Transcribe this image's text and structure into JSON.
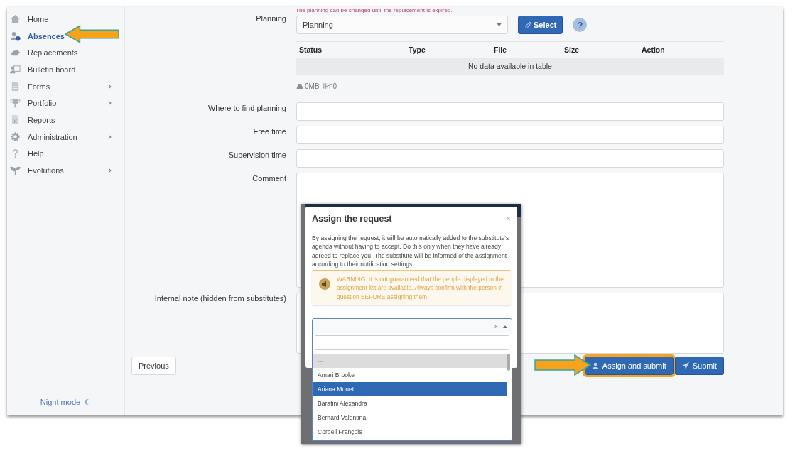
{
  "sidebar": {
    "items": [
      {
        "label": "Home",
        "selected": false,
        "has_submenu": false
      },
      {
        "label": "Absences",
        "selected": true,
        "has_submenu": false
      },
      {
        "label": "Replacements",
        "selected": false,
        "has_submenu": false
      },
      {
        "label": "Bulletin board",
        "selected": false,
        "has_submenu": false
      },
      {
        "label": "Forms",
        "selected": false,
        "has_submenu": true
      },
      {
        "label": "Portfolio",
        "selected": false,
        "has_submenu": true
      },
      {
        "label": "Reports",
        "selected": false,
        "has_submenu": false
      },
      {
        "label": "Administration",
        "selected": false,
        "has_submenu": true
      },
      {
        "label": "Help",
        "selected": false,
        "has_submenu": false
      },
      {
        "label": "Evolutions",
        "selected": false,
        "has_submenu": true
      }
    ],
    "night_mode": "Night mode"
  },
  "form": {
    "notice": "The planning can be changed until the replacement is expired.",
    "planning": {
      "label": "Planning",
      "value": "Planning",
      "select_button": "Select",
      "help": "?"
    },
    "files_table": {
      "columns": [
        "Status",
        "Type",
        "File",
        "Size",
        "Action"
      ],
      "empty_message": "No data available in table"
    },
    "storage": {
      "size": "0MB",
      "count": "0"
    },
    "fields": [
      {
        "label": "Where to find planning",
        "kind": "input"
      },
      {
        "label": "Free time",
        "kind": "input"
      },
      {
        "label": "Supervision time",
        "kind": "input"
      },
      {
        "label": "Comment",
        "kind": "textarea"
      },
      {
        "label": "Internal note (hidden from substitutes)",
        "kind": "textarea"
      }
    ]
  },
  "buttons": {
    "previous": "Previous",
    "assign": "Assign and submit",
    "submit": "Submit"
  },
  "modal": {
    "title": "Assign the request",
    "close": "×",
    "description": "By assigning the request, it will be automatically added to the substitute's agenda without having to accept. Do this only when they have already agreed to replace you. The substitute will be informed of the assignment according to their notification settings.",
    "warning": "WARNING: It is not guaranteed that the people displayed in the assignment list are available. Always confirm with the person in question BEFORE assigning them.",
    "select": {
      "value": "---",
      "clear": "×",
      "options": [
        {
          "label": "---",
          "kind": "placeholder",
          "selected": true,
          "highlighted": false
        },
        {
          "label": "Amari Brooke",
          "kind": "person",
          "selected": false,
          "highlighted": false
        },
        {
          "label": "Ariana Monet",
          "kind": "person",
          "selected": false,
          "highlighted": true
        },
        {
          "label": "Baratini Alexandra",
          "kind": "person",
          "selected": false,
          "highlighted": false
        },
        {
          "label": "Bernard Valentina",
          "kind": "person",
          "selected": false,
          "highlighted": false
        },
        {
          "label": "Corbeil François",
          "kind": "person",
          "selected": false,
          "highlighted": false
        }
      ]
    }
  }
}
